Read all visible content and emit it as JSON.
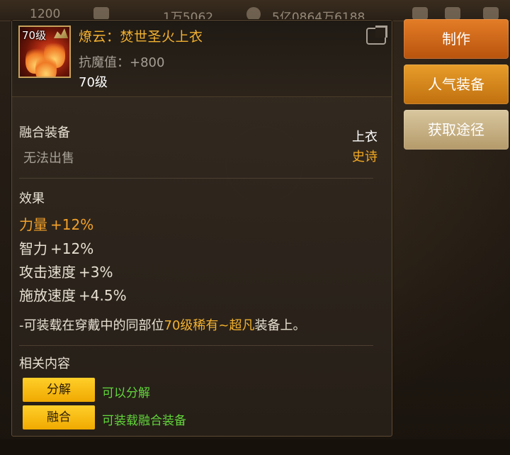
{
  "topbar": {
    "currency_1": "1200",
    "currency_2": "1万5062",
    "currency_3": "5亿0864万6188"
  },
  "item": {
    "level_badge": "70级",
    "name": "燎云：焚世圣火上衣",
    "stat": "抗魔值：+800",
    "level": "70级",
    "section_fusion": "融合装备",
    "trade_status": "无法出售",
    "slot": "上衣",
    "rarity": "史诗",
    "rarity_color": "#f3a923",
    "effects_title": "效果",
    "effects": [
      {
        "name": "力量",
        "value": "+12%"
      },
      {
        "name": "智力",
        "value": "+12%"
      },
      {
        "name": "攻击速度",
        "value": "+3%"
      },
      {
        "name": "施放速度",
        "value": "+4.5%"
      }
    ],
    "note_prefix": "-可装载在穿戴中的同部位",
    "note_highlight": "70级稀有~超凡",
    "note_suffix": "装备上。",
    "related_title": "相关内容",
    "related": [
      {
        "button": "分解",
        "desc": "可以分解"
      },
      {
        "button": "融合",
        "desc": "可装载融合装备"
      }
    ]
  },
  "side_buttons": {
    "craft": "制作",
    "popular": "人气装备",
    "source": "获取途径"
  },
  "colors": {
    "accent_gold": "#f3b12f",
    "button_yellow": "#ffcf2a",
    "green_text": "#62d63a"
  }
}
